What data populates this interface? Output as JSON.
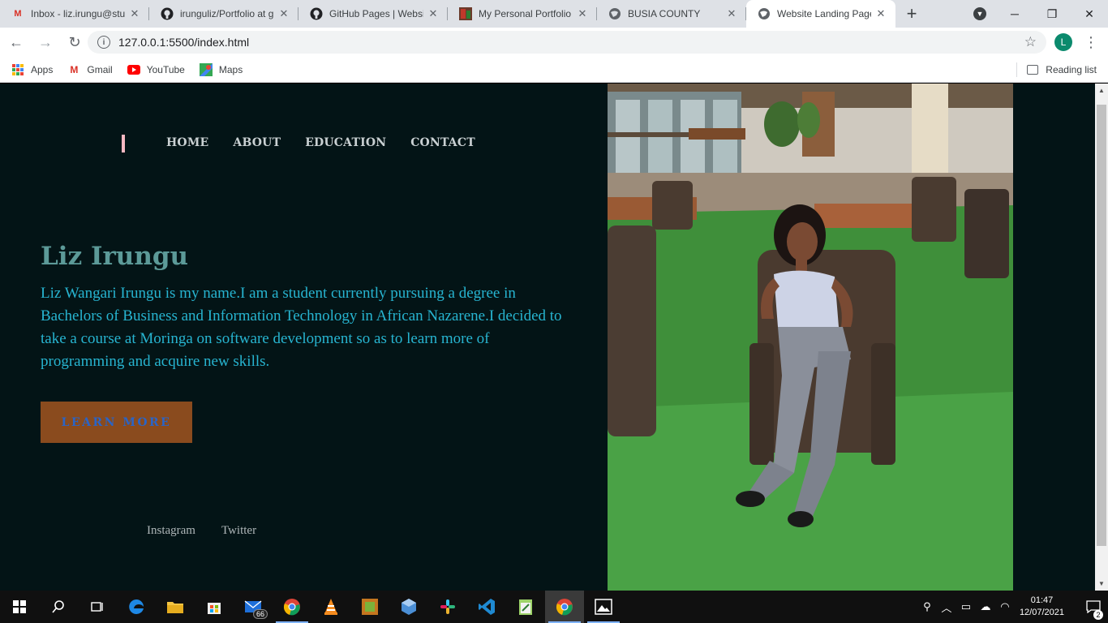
{
  "browser": {
    "tabs": [
      {
        "title": "Inbox - liz.irungu@stu",
        "icon": "gmail-icon",
        "close": "✕"
      },
      {
        "title": "irunguliz/Portfolio at g",
        "icon": "github-icon",
        "close": "✕"
      },
      {
        "title": "GitHub Pages | Websit",
        "icon": "github-icon",
        "close": "✕"
      },
      {
        "title": "My Personal Portfolio",
        "icon": "portfolio-icon",
        "close": "✕"
      },
      {
        "title": "BUSIA COUNTY",
        "icon": "globe-icon",
        "close": "✕"
      },
      {
        "title": "Website Landing Page",
        "icon": "globe-icon",
        "close": "✕",
        "active": true
      }
    ],
    "new_tab": "+",
    "address": "127.0.0.1:5500/index.html",
    "profile_initial": "L",
    "bookmarks": [
      {
        "label": "Apps",
        "icon": "apps-grid-icon"
      },
      {
        "label": "Gmail",
        "icon": "gmail-icon"
      },
      {
        "label": "YouTube",
        "icon": "youtube-icon"
      },
      {
        "label": "Maps",
        "icon": "maps-icon"
      }
    ],
    "reading_list": "Reading list"
  },
  "page": {
    "nav": [
      "HOME",
      "ABOUT",
      "EDUCATION",
      "CONTACT"
    ],
    "name": "Liz Irungu",
    "bio": "Liz Wangari Irungu is my name.I am a student currently pursuing a degree in Bachelors of Business and Information Technology in African Nazarene.I decided to take a course at Moringa on software development so as to learn more of programming and acquire new skills.",
    "cta": "LEARN MORE",
    "social": [
      "Instagram",
      "Twitter"
    ],
    "colors": {
      "background": "#031416",
      "name": "#5c9a98",
      "bio": "#27b4d0",
      "button": "#8a4b1e",
      "button_text": "#2a64c6",
      "accent": "#f7b8c2"
    }
  },
  "taskbar": {
    "mail_badge": "66",
    "time": "01:47",
    "date": "12/07/2021",
    "notifications": "2"
  }
}
